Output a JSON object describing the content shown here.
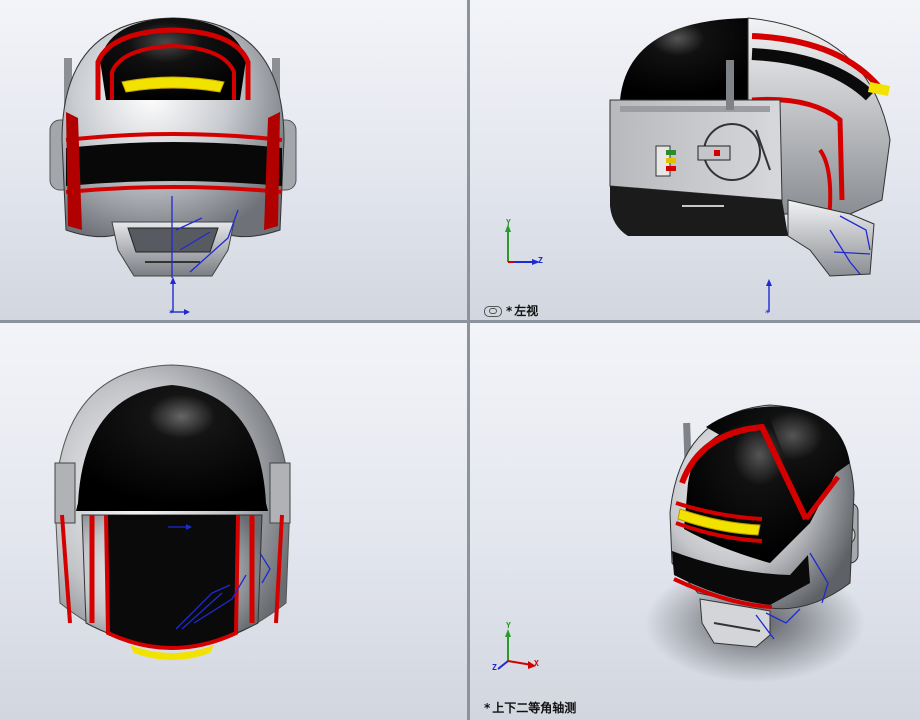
{
  "viewports": {
    "front": {
      "label": ""
    },
    "left": {
      "label": "左视",
      "asterisk": "*"
    },
    "top": {
      "label": ""
    },
    "isometric": {
      "label": "上下二等角轴测",
      "asterisk": "*"
    }
  },
  "triad": {
    "y": "Y",
    "z": "Z",
    "x": "X"
  },
  "icons": {
    "view_orientation": "view-orientation-icon",
    "origin": "origin-marker-icon"
  },
  "colors": {
    "viewport_bg_top": "#f3f4f8",
    "viewport_bg_bottom": "#d2d6df",
    "divider": "#8d939c",
    "helmet_black": "#0a0a0a",
    "helmet_red": "#d40000",
    "helmet_silver": "#c9cbcf",
    "visor_yellow": "#f2e200",
    "sketch_blue": "#1f2bd0"
  }
}
